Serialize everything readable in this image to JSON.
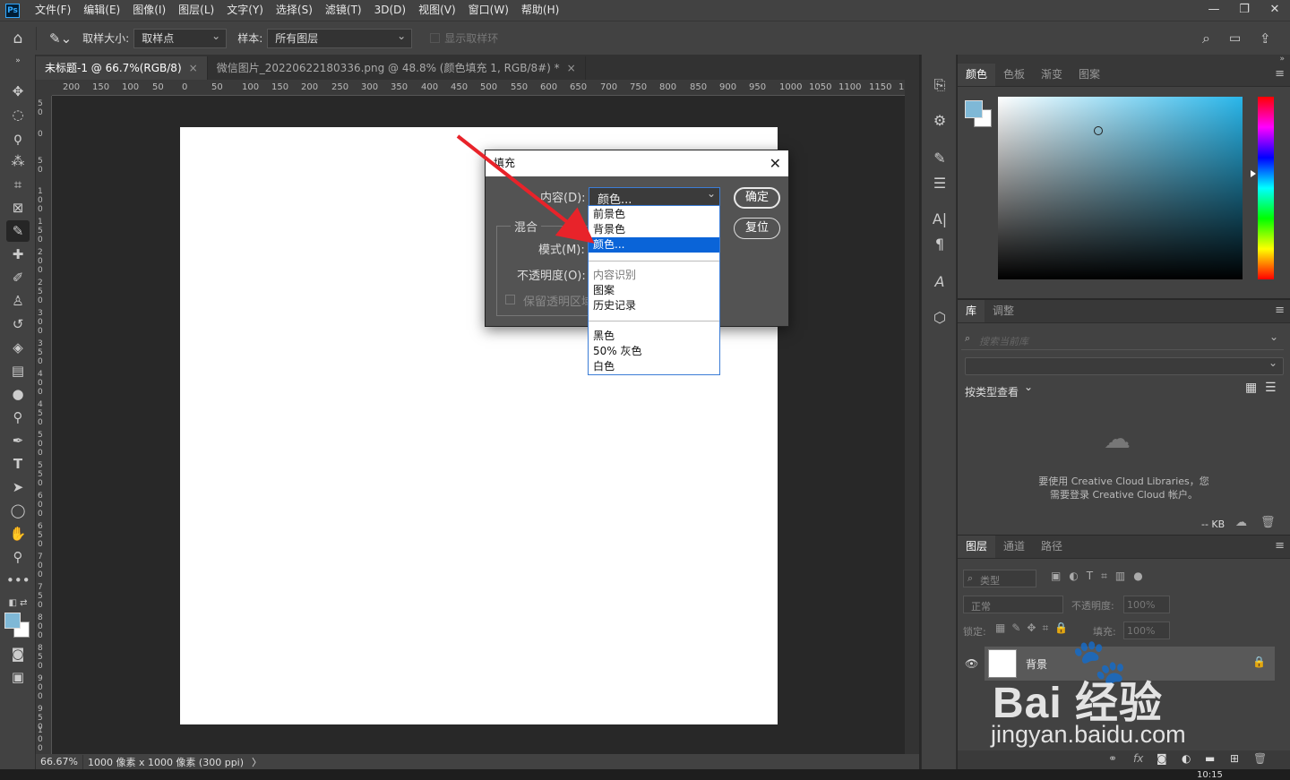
{
  "app": {
    "logo": "Ps",
    "menus": [
      "文件(F)",
      "编辑(E)",
      "图像(I)",
      "图层(L)",
      "文字(Y)",
      "选择(S)",
      "滤镜(T)",
      "3D(D)",
      "视图(V)",
      "窗口(W)",
      "帮助(H)"
    ],
    "window_controls": [
      "—",
      "❐",
      "✕"
    ]
  },
  "options_bar": {
    "sample_size_label": "取样大小:",
    "sample_size_value": "取样点",
    "sample_label": "样本:",
    "sample_value": "所有图层",
    "show_ring_label": "显示取样环"
  },
  "tabs": [
    {
      "label": "未标题-1 @ 66.7%(RGB/8)",
      "close": "×"
    },
    {
      "label": "微信图片_20220622180336.png @ 48.8% (颜色填充 1, RGB/8#) *",
      "close": "×"
    }
  ],
  "ruler_h": [
    "200",
    "150",
    "100",
    "50",
    "0",
    "50",
    "100",
    "150",
    "200",
    "250",
    "300",
    "350",
    "400",
    "450",
    "500",
    "550",
    "600",
    "650",
    "700",
    "750",
    "800",
    "850",
    "900",
    "950",
    "1000",
    "1050",
    "1100",
    "1150",
    "1"
  ],
  "ruler_v": [
    "50",
    "0",
    "50",
    "100",
    "150",
    "200",
    "250",
    "300",
    "350",
    "400",
    "450",
    "500",
    "550",
    "600",
    "650",
    "700",
    "750",
    "800",
    "850",
    "900",
    "950",
    "100"
  ],
  "status": {
    "zoom": "66.67%",
    "doc_info": "1000 像素 x 1000 像素 (300 ppi)",
    "arrow": "〉"
  },
  "dialog": {
    "title": "填充",
    "close": "✕",
    "content_label": "内容(D):",
    "content_value": "颜色...",
    "blend_group": "混合",
    "mode_label": "模式(M):",
    "opacity_label": "不透明度(O):",
    "preserve_label": "保留透明区域",
    "ok": "确定",
    "reset": "复位"
  },
  "dropdown": {
    "items": [
      "前景色",
      "背景色",
      "颜色...",
      "内容识别",
      "图案",
      "历史记录",
      "黑色",
      "50% 灰色",
      "白色"
    ],
    "selected": "颜色..."
  },
  "color_panel": {
    "tabs": [
      "颜色",
      "色板",
      "渐变",
      "图案"
    ],
    "foreground": "#7fb8d6",
    "background": "#ffffff",
    "hue": "#29b6ea"
  },
  "library_panel": {
    "tabs": [
      "库",
      "调整"
    ],
    "search_placeholder": "搜索当前库",
    "view_label": "按类型查看",
    "message_line1": "要使用 Creative Cloud Libraries，您",
    "message_line2": "需要登录 Creative Cloud 帐户。",
    "size": "-- KB"
  },
  "layers_panel": {
    "tabs": [
      "图层",
      "通道",
      "路径"
    ],
    "filter_placeholder": "类型",
    "blend_mode": "正常",
    "opacity_label": "不透明度:",
    "opacity_value": "100%",
    "lock_label": "锁定:",
    "fill_label": "填充:",
    "fill_value": "100%",
    "layer_name": "背景"
  },
  "watermark": {
    "brand": "Bai 经验",
    "url": "jingyan.baidu.com"
  },
  "taskbar_time": "10:15"
}
